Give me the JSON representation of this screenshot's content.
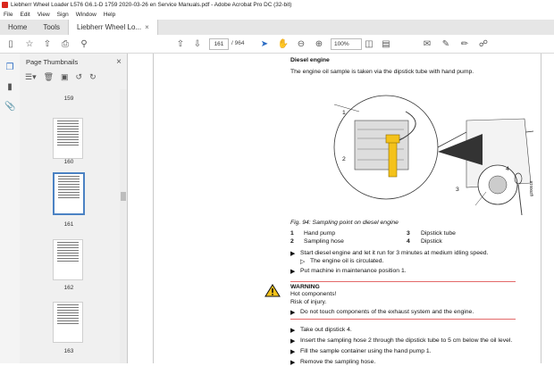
{
  "window": {
    "title": "Liebherr Wheel Loader L576 G6.1-D 1759 2020-03-26 en Service Manuals.pdf - Adobe Acrobat Pro DC (32-bit)"
  },
  "menu": [
    "File",
    "Edit",
    "View",
    "Sign",
    "Window",
    "Help"
  ],
  "tabs": {
    "home": "Home",
    "tools": "Tools",
    "doc": "Liebherr Wheel Lo..."
  },
  "toolbar": {
    "page_current": "161",
    "page_total": "/ 964",
    "zoom": "100%"
  },
  "panel": {
    "title": "Page Thumbnails"
  },
  "thumbnails": [
    "159",
    "160",
    "161",
    "162",
    "163"
  ],
  "doc": {
    "section": "Diesel engine",
    "intro": "The engine oil sample is taken via the dipstick tube with hand pump.",
    "caption": "Fig. 94: Sampling point on diesel engine",
    "legend": [
      {
        "n": "1",
        "t": "Hand pump"
      },
      {
        "n": "3",
        "t": "Dipstick tube"
      },
      {
        "n": "2",
        "t": "Sampling hose"
      },
      {
        "n": "4",
        "t": "Dipstick"
      }
    ],
    "callouts": [
      "1",
      "2",
      "3",
      "4"
    ],
    "figure_id": "g200518",
    "step1": "Start diesel engine and let it run for 3 minutes at medium idling speed.",
    "step1_result": "The engine oil is circulated.",
    "step2": "Put machine in maintenance position 1.",
    "warning_title": "WARNING",
    "warning_l1": "Hot components!",
    "warning_l2": "Risk of injury.",
    "warning_action": "Do not touch components of the exhaust system and the engine.",
    "step3": "Take out dipstick 4.",
    "step4": "Insert the sampling hose 2 through the dipstick tube to 5 cm below the oil level.",
    "step5": "Fill the sample container using the hand pump 1.",
    "step6": "Remove the sampling hose."
  }
}
